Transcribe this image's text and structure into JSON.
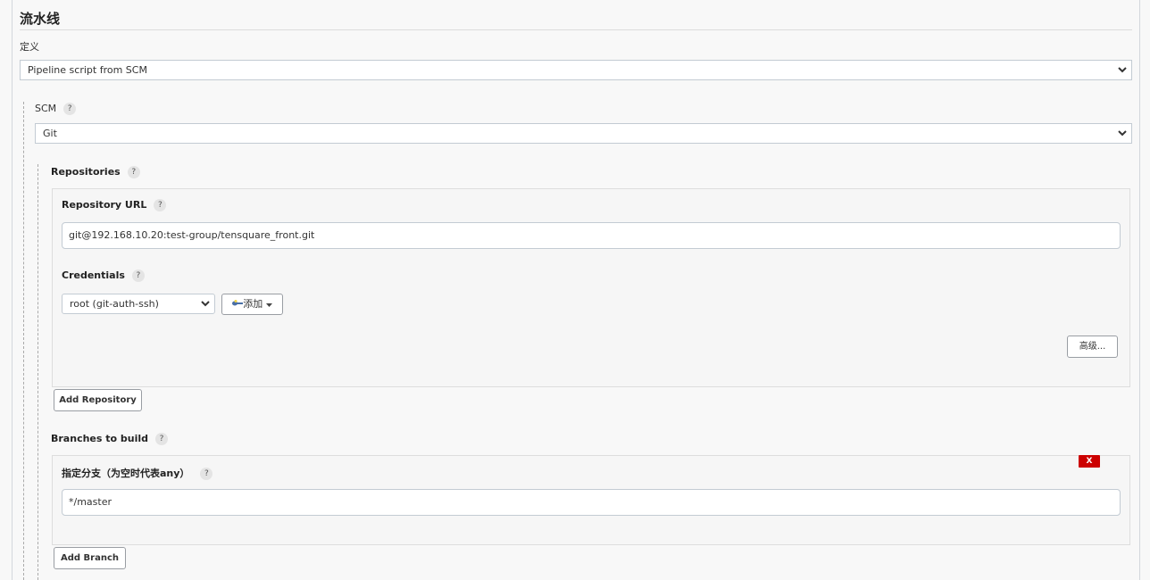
{
  "section": {
    "title": "流水线",
    "definition_label": "定义",
    "definition_value": "Pipeline script from SCM"
  },
  "scm": {
    "label": "SCM",
    "value": "Git",
    "help": "?"
  },
  "repositories": {
    "label": "Repositories",
    "help": "?",
    "url_label": "Repository URL",
    "url_value": "git@192.168.10.20:test-group/tensquare_front.git",
    "credentials_label": "Credentials",
    "credentials_value": "root (git-auth-ssh)",
    "add_label": "添加",
    "advanced_label": "高级...",
    "add_repository_label": "Add Repository"
  },
  "branches": {
    "label": "Branches to build",
    "help": "?",
    "branch_label": "指定分支（为空时代表any）",
    "branch_value": "*/master",
    "delete_label": "X",
    "add_branch_label": "Add Branch"
  },
  "colors": {
    "delete_red": "#cc0000",
    "key_blue": "#4a6fa5"
  }
}
